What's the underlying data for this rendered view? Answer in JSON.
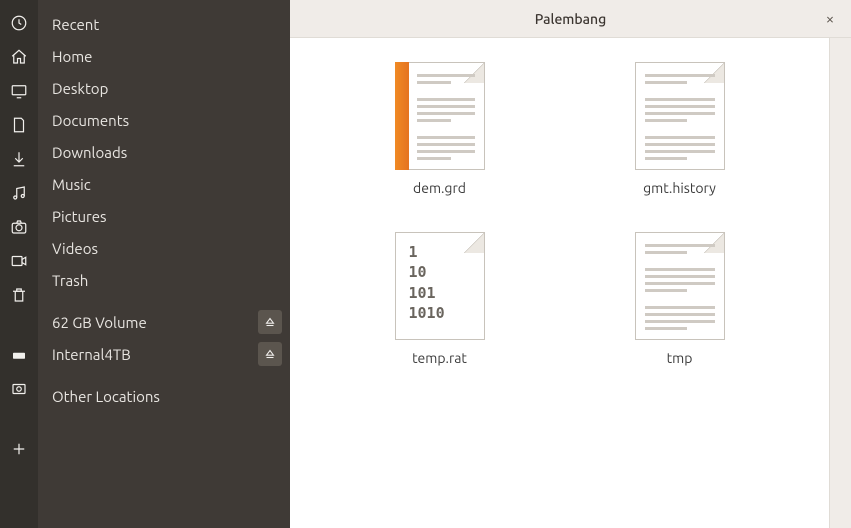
{
  "window": {
    "title": "Palembang",
    "close_glyph": "×"
  },
  "sidebar": {
    "items": [
      {
        "icon": "clock-icon",
        "label": "Recent"
      },
      {
        "icon": "home-icon",
        "label": "Home"
      },
      {
        "icon": "desktop-icon",
        "label": "Desktop"
      },
      {
        "icon": "document-icon",
        "label": "Documents"
      },
      {
        "icon": "download-icon",
        "label": "Downloads"
      },
      {
        "icon": "music-icon",
        "label": "Music"
      },
      {
        "icon": "camera-icon",
        "label": "Pictures"
      },
      {
        "icon": "video-icon",
        "label": "Videos"
      },
      {
        "icon": "trash-icon",
        "label": "Trash"
      }
    ],
    "volumes": [
      {
        "icon": "drive-icon",
        "label": "62 GB Volume",
        "ejectable": true
      },
      {
        "icon": "disk-icon",
        "label": "Internal4TB",
        "ejectable": true
      }
    ],
    "other": {
      "icon": "plus-icon",
      "label": "Other Locations"
    }
  },
  "files": [
    {
      "name": "dem.grd",
      "kind": "document-orange"
    },
    {
      "name": "gmt.history",
      "kind": "document"
    },
    {
      "name": "temp.rat",
      "kind": "binary",
      "binary_text": "1\n10\n101\n1010"
    },
    {
      "name": "tmp",
      "kind": "document"
    }
  ]
}
